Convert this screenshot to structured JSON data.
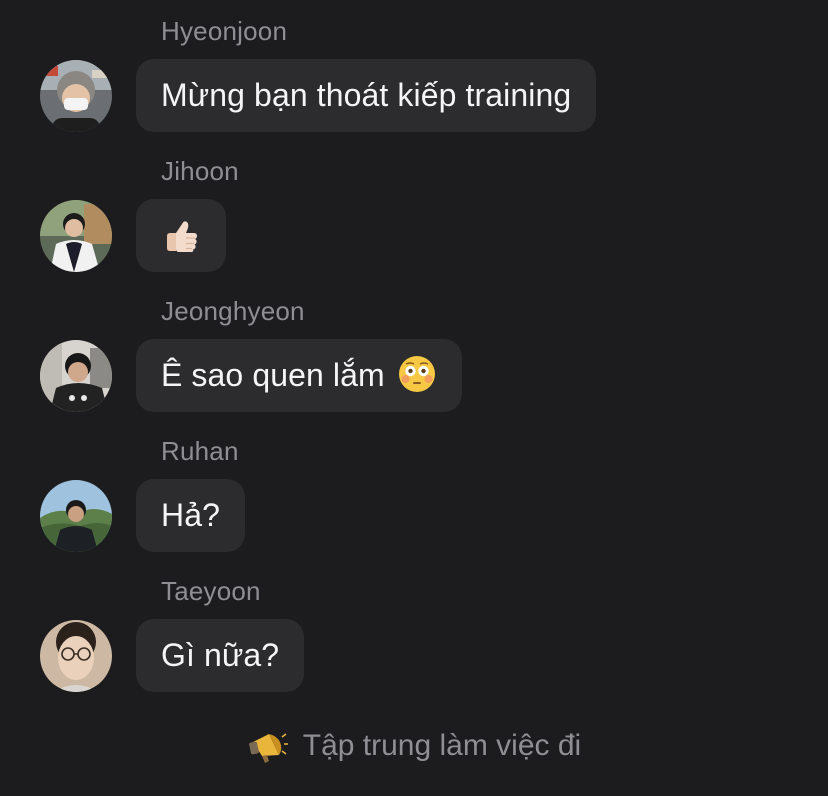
{
  "messages": [
    {
      "sender": "Hyeonjoon",
      "text": "Mừng bạn thoát kiếp training",
      "avatar_icon": "user-avatar"
    },
    {
      "sender": "Jihoon",
      "text": "",
      "emoji": "thumbs-up-icon",
      "avatar_icon": "user-avatar"
    },
    {
      "sender": "Jeonghyeon",
      "text": "Ê sao quen lắm",
      "emoji": "flushed-face-icon",
      "avatar_icon": "user-avatar"
    },
    {
      "sender": "Ruhan",
      "text": "Hả?",
      "avatar_icon": "user-avatar"
    },
    {
      "sender": "Taeyoon",
      "text": "Gì nữa?",
      "avatar_icon": "user-avatar"
    }
  ],
  "footer": {
    "icon": "megaphone-icon",
    "text": "Tập trung làm việc đi"
  },
  "colors": {
    "background": "#1c1c1e",
    "bubble": "#2c2c2e",
    "sender_text": "#8e8e93",
    "message_text": "#f5f5f7"
  }
}
